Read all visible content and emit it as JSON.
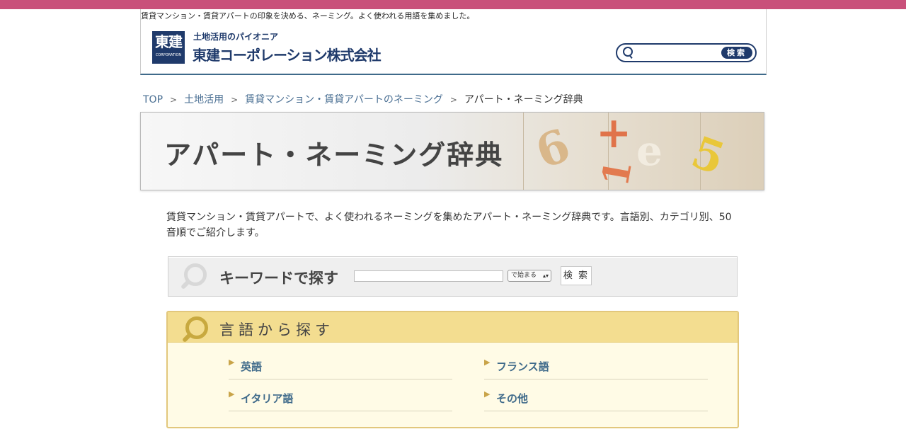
{
  "header": {
    "tagline": "賃貸マンション・賃貸アパートの印象を決める、ネーミング。よく使われる用語を集めました。",
    "logo_mark_kanji": "東建",
    "logo_mark_caption": "CORPORATION",
    "logo_sub": "土地活用のパイオニア",
    "logo_name": "東建コーポレーション株式会社",
    "search_button": "検索",
    "search_placeholder": ""
  },
  "breadcrumb": {
    "items": [
      "TOP",
      "土地活用",
      "賃貸マンション・賃貸アパートのネーミング"
    ],
    "current": "アパート・ネーミング辞典"
  },
  "banner": {
    "title": "アパート・ネーミング辞典",
    "decorations": [
      "6",
      "+",
      "1",
      "e",
      "5"
    ]
  },
  "intro": {
    "text": "賃貸マンション・賃貸アパートで、よく使われるネーミングを集めたアパート・ネーミング辞典です。言語別、カテゴリ別、50音順でご紹介します。"
  },
  "keyword_search": {
    "title": "キーワードで探す",
    "input_value": "",
    "select_value": "で始まる",
    "button": "検 索"
  },
  "language_search": {
    "title": "言語から探す",
    "items": [
      {
        "label": "英語"
      },
      {
        "label": "フランス語"
      },
      {
        "label": "イタリア語"
      },
      {
        "label": "その他"
      }
    ]
  },
  "colors": {
    "top_bar": "#c9507a",
    "brand_navy": "#1f3a6b",
    "link_blue": "#4a6f93",
    "lang_header": "#f3dd90",
    "lang_bg": "#fffbe6"
  }
}
